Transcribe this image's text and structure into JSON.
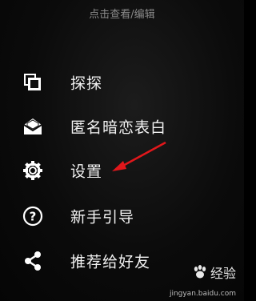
{
  "header": {
    "title": "点击查看/编辑"
  },
  "menu": {
    "items": [
      {
        "label": "探探",
        "icon": "cards-stack-icon"
      },
      {
        "label": "匿名暗恋表白",
        "icon": "open-envelope-icon"
      },
      {
        "label": "设置",
        "icon": "gear-icon"
      },
      {
        "label": "新手引导",
        "icon": "help-circle-icon"
      },
      {
        "label": "推荐给好友",
        "icon": "share-icon"
      }
    ]
  },
  "annotation": {
    "arrow_color": "#e0171b"
  },
  "watermark": {
    "logo_text": "经验",
    "url": "jingyan.baidu.com"
  }
}
